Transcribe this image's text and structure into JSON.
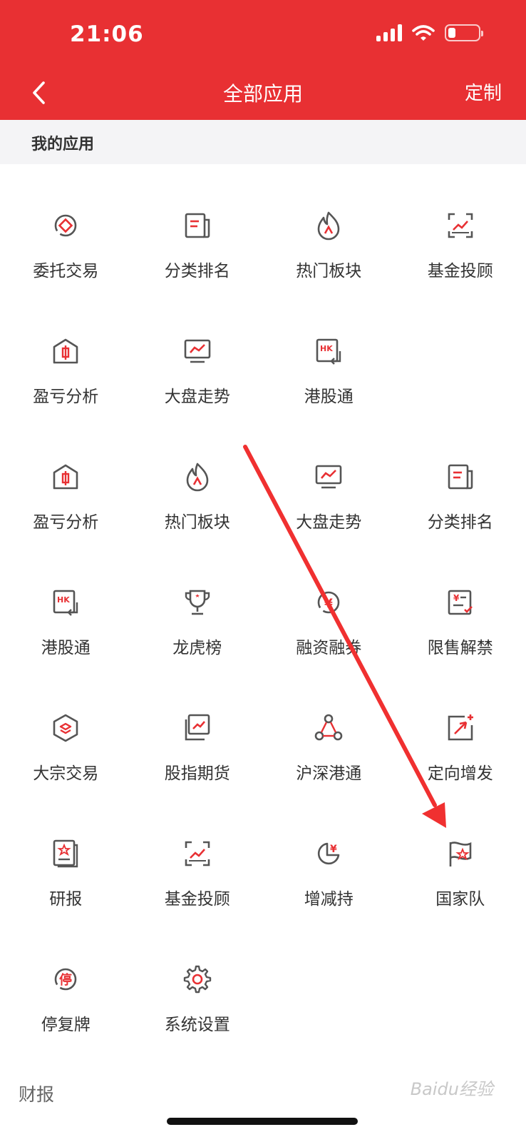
{
  "status_bar": {
    "time": "21:06"
  },
  "nav": {
    "title": "全部应用",
    "action": "定制"
  },
  "section": {
    "title": "我的应用"
  },
  "apps": [
    [
      {
        "label": "委托交易",
        "icon": "trade-icon"
      },
      {
        "label": "分类排名",
        "icon": "ranking-icon"
      },
      {
        "label": "热门板块",
        "icon": "flame-icon"
      },
      {
        "label": "基金投顾",
        "icon": "fund-advisor-icon"
      }
    ],
    [
      {
        "label": "盈亏分析",
        "icon": "profit-analysis-icon"
      },
      {
        "label": "大盘走势",
        "icon": "market-trend-icon"
      },
      {
        "label": "港股通",
        "icon": "hk-connect-icon"
      }
    ],
    [
      {
        "label": "盈亏分析",
        "icon": "profit-analysis-icon"
      },
      {
        "label": "热门板块",
        "icon": "flame-icon"
      },
      {
        "label": "大盘走势",
        "icon": "market-trend-icon"
      },
      {
        "label": "分类排名",
        "icon": "ranking-icon"
      }
    ],
    [
      {
        "label": "港股通",
        "icon": "hk-connect-icon"
      },
      {
        "label": "龙虎榜",
        "icon": "trophy-icon"
      },
      {
        "label": "融资融券",
        "icon": "margin-trading-icon"
      },
      {
        "label": "限售解禁",
        "icon": "lockup-release-icon"
      }
    ],
    [
      {
        "label": "大宗交易",
        "icon": "block-trade-icon"
      },
      {
        "label": "股指期货",
        "icon": "index-futures-icon"
      },
      {
        "label": "沪深港通",
        "icon": "connect-network-icon"
      },
      {
        "label": "定向增发",
        "icon": "private-placement-icon"
      }
    ],
    [
      {
        "label": "研报",
        "icon": "research-report-icon"
      },
      {
        "label": "基金投顾",
        "icon": "fund-advisor-icon"
      },
      {
        "label": "增减持",
        "icon": "pie-yen-icon"
      },
      {
        "label": "国家队",
        "icon": "flag-icon"
      }
    ],
    [
      {
        "label": "停复牌",
        "icon": "suspension-icon"
      },
      {
        "label": "系统设置",
        "icon": "gear-icon"
      }
    ]
  ],
  "bottom_section": {
    "title": "财报"
  },
  "watermark": "Baidu经验",
  "colors": {
    "brand_red": "#e83033",
    "icon_gray": "#555555",
    "icon_red": "#e83033"
  }
}
